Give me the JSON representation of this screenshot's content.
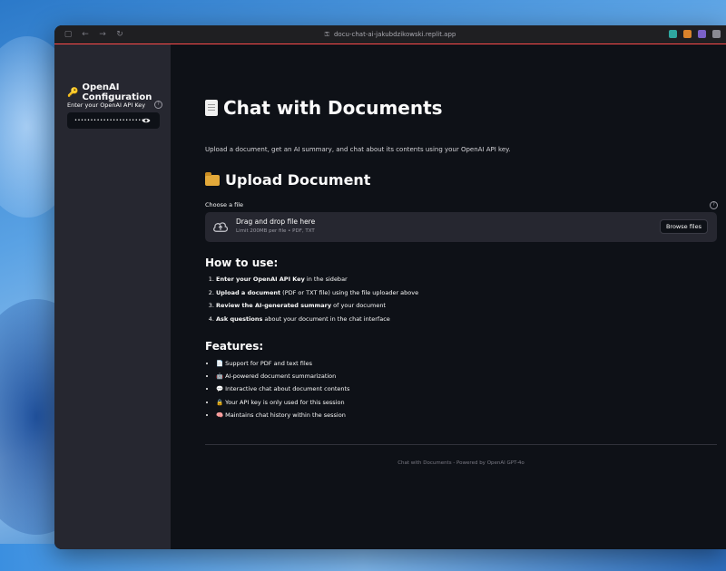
{
  "browser": {
    "url": "docu-chat-ai-jakubdzikowski.replit.app",
    "toolbar_icons": [
      "sidebar-icon",
      "back-icon",
      "forward-icon",
      "reload-icon"
    ],
    "extension_colors": [
      "#2fa7a0",
      "#d9822b",
      "#7b61c9",
      "#8a8a93"
    ]
  },
  "sidebar": {
    "title": "OpenAI Configuration",
    "title_icon": "key-icon",
    "api_key_label": "Enter your OpenAI API Key",
    "api_key_value": "••••••••••••••••••••••••••••••••"
  },
  "main": {
    "title": "Chat with Documents",
    "subtitle": "Upload a document, get an AI summary, and chat about its contents using your OpenAI API key.",
    "upload_heading": "Upload Document",
    "choose_label": "Choose a file",
    "dropzone": {
      "title": "Drag and drop file here",
      "limit": "Limit 200MB per file • PDF, TXT",
      "browse_label": "Browse files"
    },
    "howto_heading": "How to use:",
    "steps": [
      {
        "bold": "Enter your OpenAI API Key",
        "rest": " in the sidebar"
      },
      {
        "bold": "Upload a document",
        "rest": " (PDF or TXT file) using the file uploader above"
      },
      {
        "bold": "Review the AI-generated summary",
        "rest": " of your document"
      },
      {
        "bold": "Ask questions",
        "rest": " about your document in the chat interface"
      }
    ],
    "features_heading": "Features:",
    "features": [
      {
        "icon": "📄",
        "text": "Support for PDF and text files"
      },
      {
        "icon": "🤖",
        "text": "AI-powered document summarization"
      },
      {
        "icon": "💬",
        "text": "Interactive chat about document contents"
      },
      {
        "icon": "🔒",
        "text": "Your API key is only used for this session"
      },
      {
        "icon": "🧠",
        "text": "Maintains chat history within the session"
      }
    ],
    "footer": "Chat with Documents - Powered by OpenAI GPT-4o"
  },
  "colors": {
    "accent": "#ff4b4b",
    "background": "#0e1117",
    "sidebar": "#262730"
  }
}
